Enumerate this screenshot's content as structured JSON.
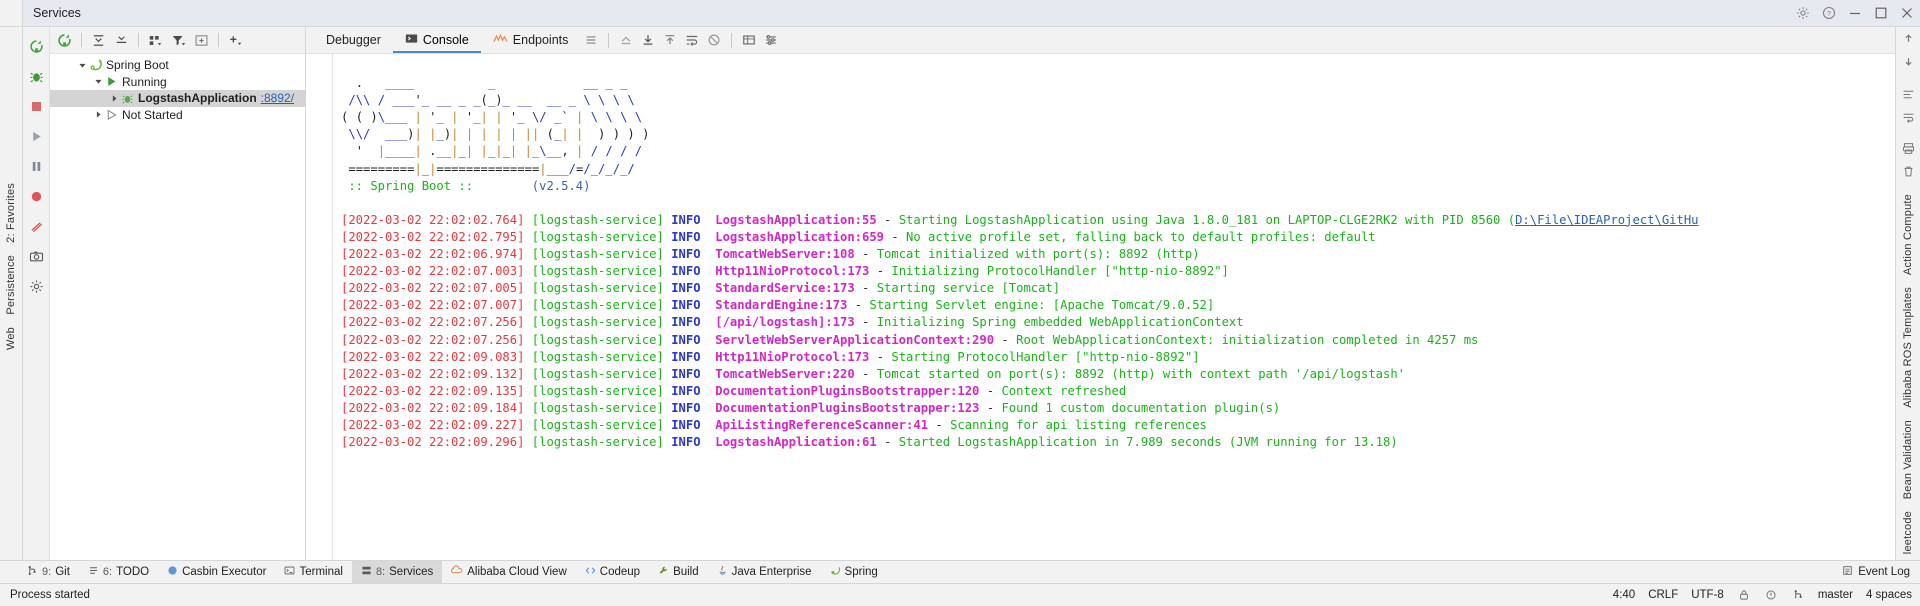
{
  "window": {
    "title": "Services",
    "top_icons": [
      "settings-icon",
      "help-icon",
      "minimize-icon",
      "maximize-icon",
      "close-icon"
    ]
  },
  "services_toolbar": {
    "icons": [
      "rerun-icon",
      "expand-all-icon",
      "collapse-all-icon",
      "group-by-icon",
      "filter-icon",
      "add-tab-icon",
      "add-icon"
    ]
  },
  "services_vertical_toolbar": {
    "icons": [
      "rerun-icon",
      "debug-icon",
      "stop-icon",
      "resume-icon",
      "pause-icon",
      "camera-icon",
      "settings-icon"
    ]
  },
  "tree": {
    "nodes": [
      {
        "label": "Spring Boot",
        "icon": "spring-boot-icon",
        "depth": 0,
        "expanded": true,
        "bold": false,
        "selected": false,
        "port": ""
      },
      {
        "label": "Running",
        "icon": "run-icon",
        "depth": 1,
        "expanded": true,
        "bold": false,
        "selected": false,
        "port": ""
      },
      {
        "label": "LogstashApplication",
        "icon": "spring-app-icon",
        "depth": 2,
        "expanded": false,
        "bold": true,
        "selected": true,
        "port": ":8892/"
      },
      {
        "label": "Not Started",
        "icon": "not-started-icon",
        "depth": 1,
        "expanded": false,
        "bold": false,
        "selected": false,
        "port": ""
      }
    ]
  },
  "console_tabs": [
    {
      "label": "Debugger",
      "icon": "",
      "active": false
    },
    {
      "label": "Console",
      "icon": "console-icon",
      "active": true
    },
    {
      "label": "Endpoints",
      "icon": "endpoints-icon",
      "active": false
    }
  ],
  "console_toolbar": {
    "icons": [
      "layout-icon",
      "step-out-icon",
      "scroll-down-icon",
      "soft-wrap-icon",
      "print-icon",
      "clear-icon",
      "table-icon",
      "settings-icon"
    ]
  },
  "banner": {
    "lines": [
      "  .   ____          _            __ _ _",
      " /\\\\ / ___'_ __ _ _(_)_ __  __ _ \\ \\ \\ \\",
      "( ( )\\___ | '_ | '_| | '_ \\/ _` | \\ \\ \\ \\",
      " \\\\/  ___)| |_)| | | | | || (_| |  ) ) ) )",
      "  '  |____| .__|_| |_|_| |_\\__, | / / / /",
      " =========|_|==============|___/=/_/_/_/"
    ],
    "footer_left": " :: Spring Boot :: ",
    "footer_right": "       (v2.5.4)"
  },
  "log": {
    "service": "[logstash-service]",
    "level": "INFO",
    "entries": [
      {
        "ts": "[2022-03-02 22:02:02.764]",
        "cls": "LogstashApplication:55",
        "msg": "Starting LogstashApplication using Java 1.8.0_181 on LAPTOP-CLGE2RK2 with PID 8560 (",
        "link": "D:\\File\\IDEAProject\\GitHu"
      },
      {
        "ts": "[2022-03-02 22:02:02.795]",
        "cls": "LogstashApplication:659",
        "msg": "No active profile set, falling back to default profiles: default",
        "link": ""
      },
      {
        "ts": "[2022-03-02 22:02:06.974]",
        "cls": "TomcatWebServer:108",
        "msg": "Tomcat initialized with port(s): 8892 (http)",
        "link": ""
      },
      {
        "ts": "[2022-03-02 22:02:07.003]",
        "cls": "Http11NioProtocol:173",
        "msg": "Initializing ProtocolHandler [\"http-nio-8892\"]",
        "link": ""
      },
      {
        "ts": "[2022-03-02 22:02:07.005]",
        "cls": "StandardService:173",
        "msg": "Starting service [Tomcat]",
        "link": ""
      },
      {
        "ts": "[2022-03-02 22:02:07.007]",
        "cls": "StandardEngine:173",
        "msg": "Starting Servlet engine: [Apache Tomcat/9.0.52]",
        "link": ""
      },
      {
        "ts": "[2022-03-02 22:02:07.256]",
        "cls": "[/api/logstash]:173",
        "msg": "Initializing Spring embedded WebApplicationContext",
        "link": ""
      },
      {
        "ts": "[2022-03-02 22:02:07.256]",
        "cls": "ServletWebServerApplicationContext:290",
        "msg": "Root WebApplicationContext: initialization completed in 4257 ms",
        "link": ""
      },
      {
        "ts": "[2022-03-02 22:02:09.083]",
        "cls": "Http11NioProtocol:173",
        "msg": "Starting ProtocolHandler [\"http-nio-8892\"]",
        "link": ""
      },
      {
        "ts": "[2022-03-02 22:02:09.132]",
        "cls": "TomcatWebServer:220",
        "msg": "Tomcat started on port(s): 8892 (http) with context path '/api/logstash'",
        "link": ""
      },
      {
        "ts": "[2022-03-02 22:02:09.135]",
        "cls": "DocumentationPluginsBootstrapper:120",
        "msg": "Context refreshed",
        "link": ""
      },
      {
        "ts": "[2022-03-02 22:02:09.184]",
        "cls": "DocumentationPluginsBootstrapper:123",
        "msg": "Found 1 custom documentation plugin(s)",
        "link": ""
      },
      {
        "ts": "[2022-03-02 22:02:09.227]",
        "cls": "ApiListingReferenceScanner:41",
        "msg": "Scanning for api listing references",
        "link": ""
      },
      {
        "ts": "[2022-03-02 22:02:09.296]",
        "cls": "LogstashApplication:61",
        "msg": "Started LogstashApplication in 7.989 seconds (JVM running for 13.18)",
        "link": ""
      }
    ]
  },
  "left_strip": [
    {
      "label": "2: Favorites",
      "icon": "star-icon"
    },
    {
      "label": "Persistence",
      "icon": "db-icon"
    },
    {
      "label": "Web",
      "icon": "web-icon"
    }
  ],
  "right_strip": {
    "items": [
      {
        "label": "Action Compute",
        "icon": "action-icon"
      },
      {
        "label": "Alibaba ROS Templates",
        "icon": "cloud-icon"
      },
      {
        "label": "Bean Validation",
        "icon": "bean-icon"
      },
      {
        "label": "leetcode",
        "icon": "code-icon"
      }
    ],
    "icons": [
      "collapse-up-icon",
      "collapse-down-icon",
      "layout-icon",
      "print-icon",
      "trash-icon"
    ]
  },
  "bottom_tabs": [
    {
      "num": "",
      "label": "Git",
      "prefix": "9:",
      "icon": "git-icon",
      "active": false
    },
    {
      "num": "",
      "label": "TODO",
      "prefix": "6:",
      "icon": "todo-icon",
      "active": false
    },
    {
      "num": "",
      "label": "Casbin Executor",
      "prefix": "",
      "icon": "casbin-icon",
      "active": false
    },
    {
      "num": "",
      "label": "Terminal",
      "prefix": "",
      "icon": "terminal-icon",
      "active": false
    },
    {
      "num": "",
      "label": "Services",
      "prefix": "8:",
      "icon": "services-icon",
      "active": true
    },
    {
      "num": "",
      "label": "Alibaba Cloud View",
      "prefix": "",
      "icon": "alibaba-icon",
      "active": false
    },
    {
      "num": "",
      "label": "Codeup",
      "prefix": "",
      "icon": "codeup-icon",
      "active": false
    },
    {
      "num": "",
      "label": "Build",
      "prefix": "",
      "icon": "build-icon",
      "active": false
    },
    {
      "num": "",
      "label": "Java Enterprise",
      "prefix": "",
      "icon": "java-icon",
      "active": false
    },
    {
      "num": "",
      "label": "Spring",
      "prefix": "",
      "icon": "spring-icon",
      "active": false
    }
  ],
  "event_log": {
    "label": "Event Log",
    "icon": "event-log-icon"
  },
  "status": {
    "message": "Process started",
    "caret": "4:40",
    "line_sep": "CRLF",
    "encoding": "UTF-8",
    "branch": "master",
    "indent": "4 spaces"
  }
}
